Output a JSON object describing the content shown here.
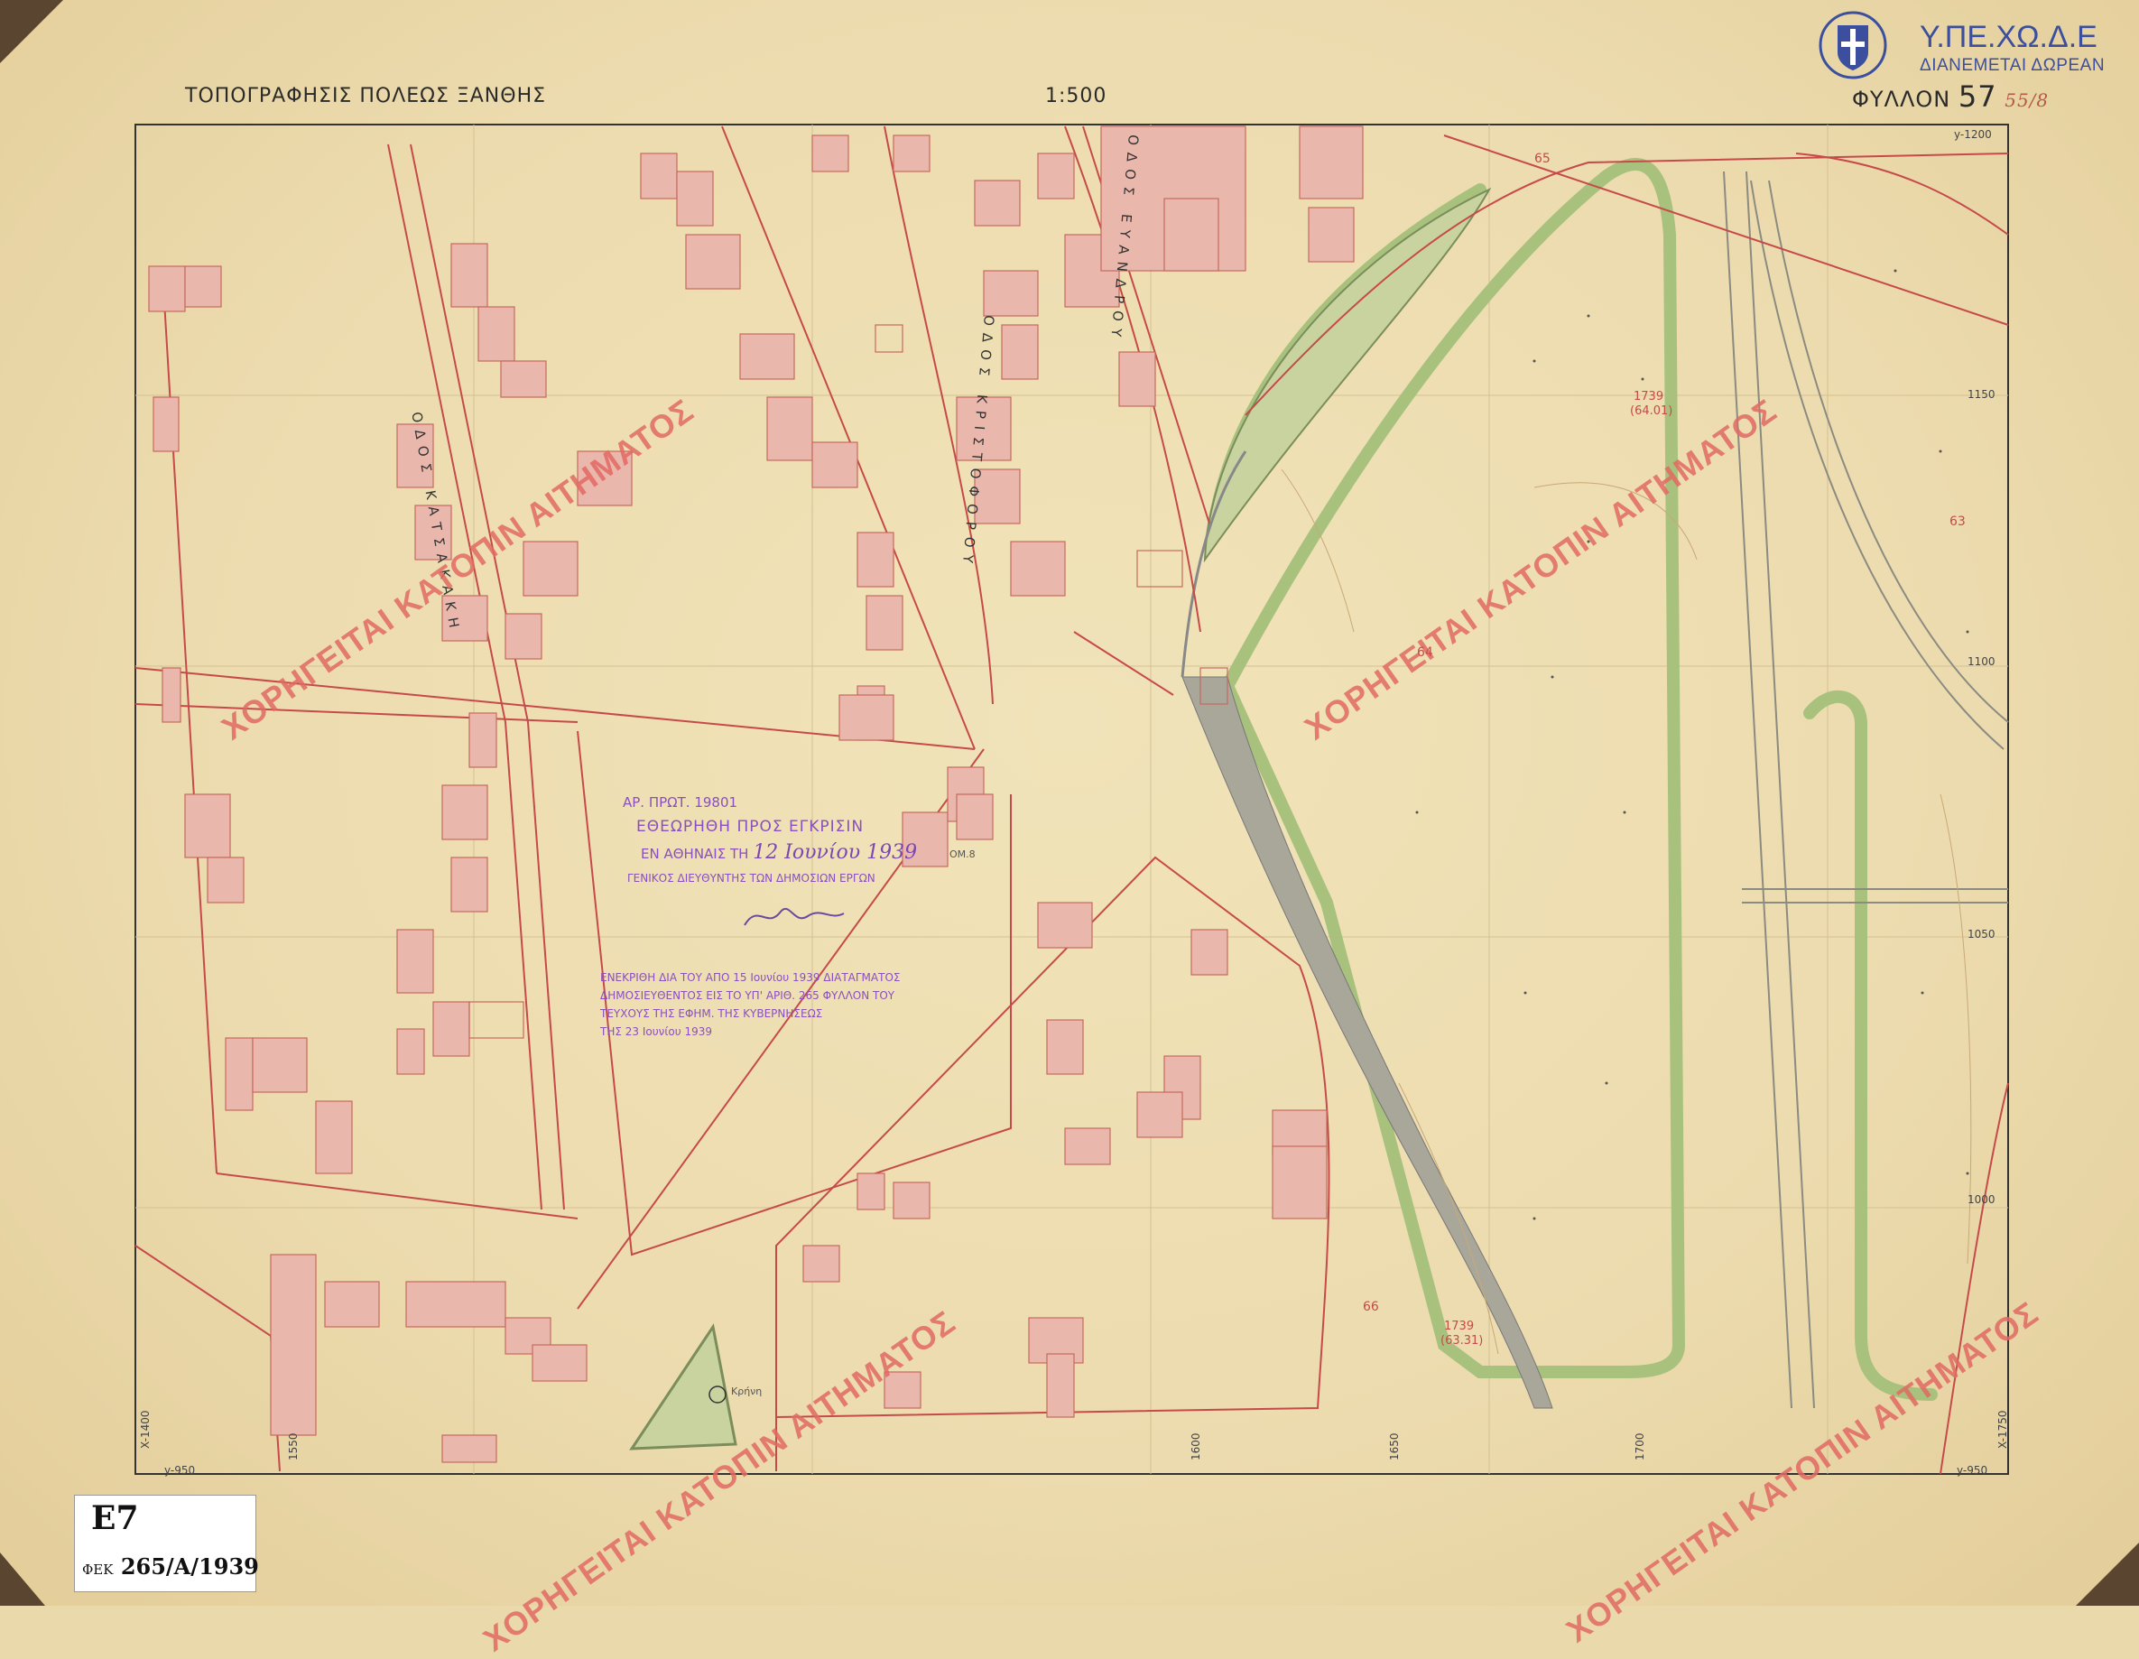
{
  "header": {
    "title": "ΤΟΠΟΓΡΑΦΗΣΙΣ ΠΟΛΕΩΣ ΞΑΝΘΗΣ",
    "scale": "1:500",
    "sheet_label": "ΦΥΛΛΟΝ",
    "sheet_number": "57",
    "sheet_handwritten": "55/8"
  },
  "logo": {
    "line1": "Υ.ΠΕ.ΧΩ.Δ.Ε",
    "line2": "ΔΙΑΝΕΜΕΤΑΙ ΔΩΡΕΑΝ",
    "icon": "greek-coat-of-arms-icon"
  },
  "streets": [
    {
      "label": "ΟΔΟΣ ΚΑΤΣΑΚΑΚΗ"
    },
    {
      "label": "ΟΔΟΣ ΚΡΙΣΤΟΦΟΡΟΥ"
    },
    {
      "label": "ΟΔΟΣ ΕΥΑΝΔΡΟΥ"
    }
  ],
  "watermark_text": "ΧΟΡΗΓΕΙΤΑΙ ΚΑΤΟΠΙΝ ΑΙΤΗΜΑΤΟΣ",
  "stamps": {
    "protocol": "ΑΡ. ΠΡΩΤ. 19801",
    "review": "ΕΘΕΩΡΗΘΗ ΠΡΟΣ ΕΓΚΡΙΣΙΝ",
    "review_date_prefix": "ΕΝ ΑΘΗΝΑΙΣ ΤΗ",
    "review_date": "12 Ιουνίου 1939",
    "director": "ΓΕΝΙΚΟΣ ΔΙΕΥΘΥΝΤΗΣ ΤΩΝ ΔΗΜΟΣΙΩΝ ΕΡΓΩΝ",
    "approval_l1": "ΕΝΕΚΡΙΘΗ ΔΙΑ ΤΟΥ ΑΠΟ 15 Ιουνίου 1939 ΔΙΑΤΑΓΜΑΤΟΣ",
    "approval_l2": "ΔΗΜΟΣΙΕΥΘΕΝΤΟΣ ΕΙΣ ΤΟ ΥΠ' ΑΡΙΘ. 265 ΦΥΛΛΟΝ ΤΟΥ",
    "approval_l3": "ΤΕΥΧΟΥΣ ΤΗΣ ΕΦΗΜ. ΤΗΣ ΚΥΒΕΡΝΗΣΕΩΣ",
    "approval_l4": "ΤΗΣ 23 Ιουνίου 1939"
  },
  "reference_label": {
    "code": "E7",
    "fek_prefix": "ΦΕΚ",
    "fek": "265/A/1939"
  },
  "axes": {
    "bottom": [
      "1550",
      "1600",
      "1650",
      "1700"
    ],
    "right": [
      "1150",
      "1100",
      "1050",
      "1000"
    ],
    "corner_bl": "y-950",
    "corner_br": "y-950",
    "corner_tr": "y-1200",
    "corner_left_vertical": "X-1400",
    "corner_right_vertical": "X-1750"
  },
  "annotations": {
    "block1": "1739",
    "block1_sub": "(64.01)",
    "block2": "1739",
    "block2_sub": "(63.31)",
    "contour65": "65",
    "contour66": "66",
    "contour64": "64",
    "contour63": "63",
    "kiosk": "Κρήνη",
    "om8": "ΟΜ.8"
  },
  "colors": {
    "paper": "#ecdbae",
    "building_fill": "#eab7ad",
    "property_line": "#c64a4a",
    "green_band": "#a8c27e",
    "watermark": "#e26a64",
    "stamp": "#8a4fc0",
    "logo": "#3b4f9e"
  }
}
